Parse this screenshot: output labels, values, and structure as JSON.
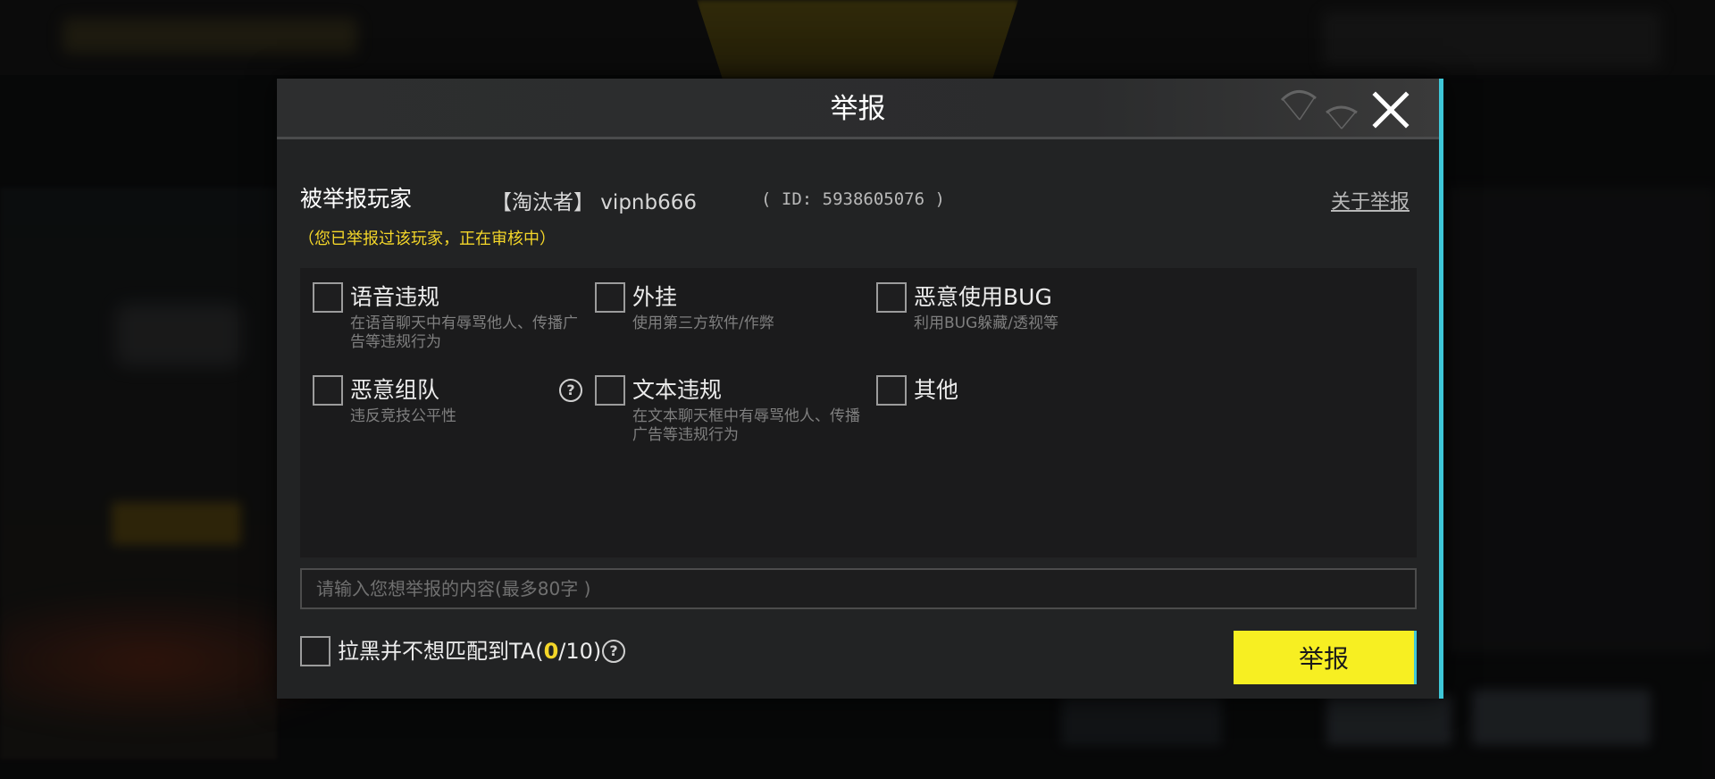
{
  "dialog": {
    "title": "举报",
    "reported_label": "被举报玩家",
    "player_name": "【淘汰者】 vipnb666",
    "player_id": "( ID: 5938605076 )",
    "about_link": "关于举报",
    "status_note": "（您已举报过该玩家，正在审核中）"
  },
  "options": [
    {
      "label": "语音违规",
      "desc": "在语音聊天中有辱骂他人、传播广告等违规行为",
      "checked": false
    },
    {
      "label": "外挂",
      "desc": "使用第三方软件/作弊",
      "checked": false
    },
    {
      "label": "恶意使用BUG",
      "desc": "利用BUG躲藏/透视等",
      "checked": false
    },
    {
      "label": "恶意组队",
      "desc": "违反竞技公平性",
      "checked": false,
      "has_help": true
    },
    {
      "label": "文本违规",
      "desc": "在文本聊天框中有辱骂他人、传播广告等违规行为",
      "checked": false
    },
    {
      "label": "其他",
      "desc": "",
      "checked": false
    }
  ],
  "input": {
    "placeholder": "请输入您想举报的内容(最多80字 )",
    "value": ""
  },
  "block": {
    "prefix": "拉黑并不想匹配到TA(",
    "count": "0",
    "suffix": "/10)"
  },
  "submit_label": "举报",
  "help_glyph": "?",
  "colors": {
    "accent_yellow": "#f7ef22",
    "note_yellow": "#f4d629",
    "edge_cyan": "#3ec7d8",
    "panel_bg": "#222324"
  }
}
